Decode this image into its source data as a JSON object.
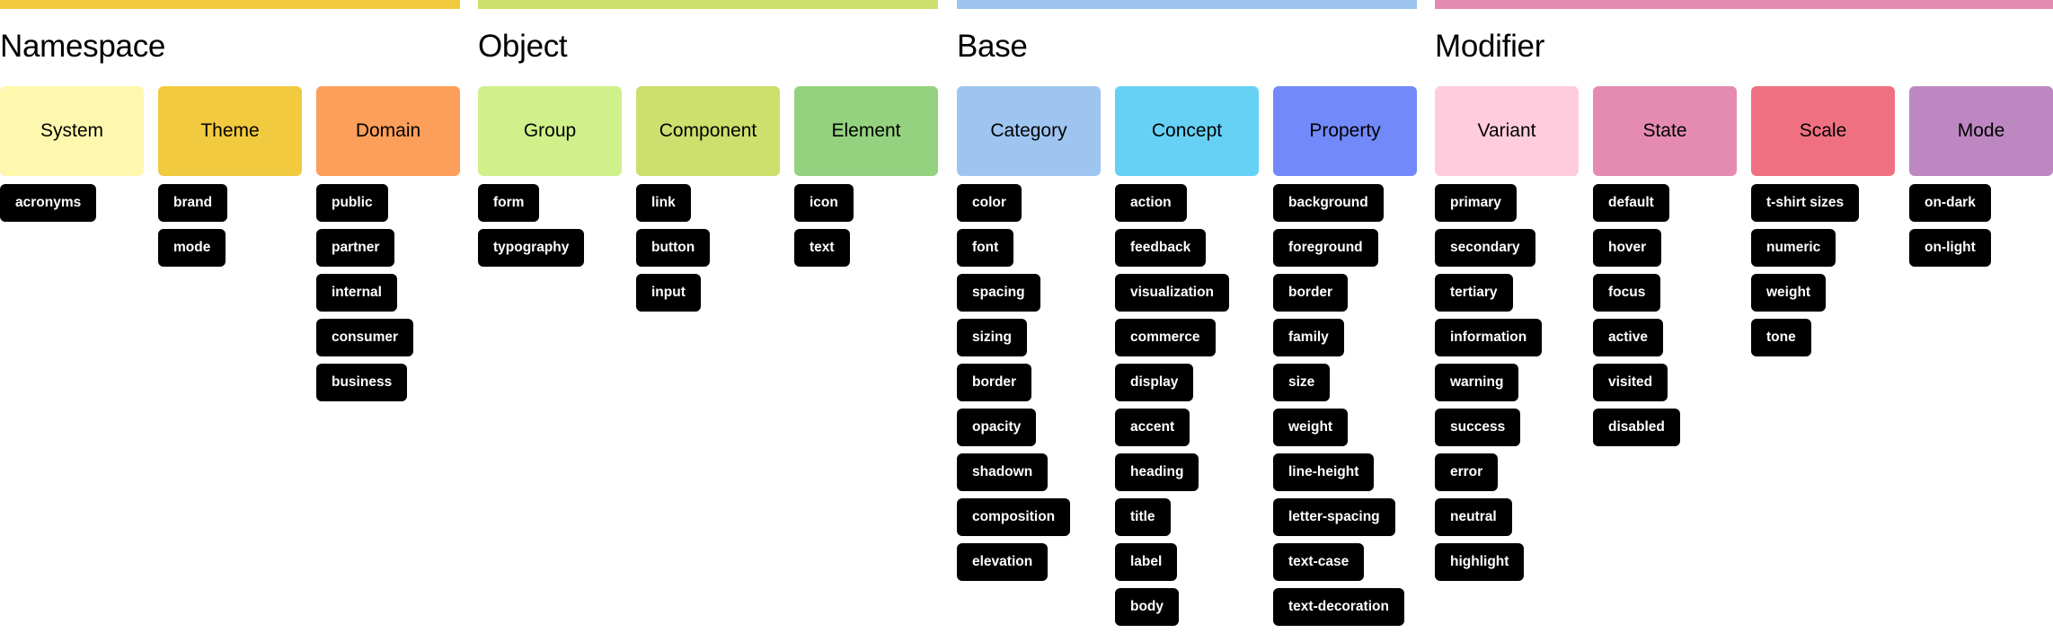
{
  "sections": [
    {
      "title": "Namespace",
      "color": "#F2CA3F",
      "columns": [
        {
          "label": "System",
          "color": "#FEF7AE",
          "tags": [
            "acronyms"
          ]
        },
        {
          "label": "Theme",
          "color": "#F2CA3F",
          "tags": [
            "brand",
            "mode"
          ]
        },
        {
          "label": "Domain",
          "color": "#FB9F5A",
          "tags": [
            "public",
            "partner",
            "internal",
            "consumer",
            "business"
          ]
        }
      ]
    },
    {
      "title": "Object",
      "color": "#CDDF6C",
      "columns": [
        {
          "label": "Group",
          "color": "#D0F08B",
          "tags": [
            "form",
            "typography"
          ]
        },
        {
          "label": "Component",
          "color": "#CDDF6C",
          "tags": [
            "link",
            "button",
            "input"
          ]
        },
        {
          "label": "Element",
          "color": "#95D27F",
          "tags": [
            "icon",
            "text"
          ]
        }
      ]
    },
    {
      "title": "Base",
      "color": "#9DC5F0",
      "columns": [
        {
          "label": "Category",
          "color": "#9DC5F0",
          "tags": [
            "color",
            "font",
            "spacing",
            "sizing",
            "border",
            "opacity",
            "shadown",
            "composition",
            "elevation"
          ]
        },
        {
          "label": "Concept",
          "color": "#66D1F4",
          "tags": [
            "action",
            "feedback",
            "visualization",
            "commerce",
            "display",
            "accent",
            "heading",
            "title",
            "label",
            "body"
          ]
        },
        {
          "label": "Property",
          "color": "#7289F9",
          "tags": [
            "background",
            "foreground",
            "border",
            "family",
            "size",
            "weight",
            "line-height",
            "letter-spacing",
            "text-case",
            "text-decoration"
          ]
        }
      ]
    },
    {
      "title": "Modifier",
      "color": "#E58BB1",
      "columns": [
        {
          "label": "Variant",
          "color": "#FFCCDE",
          "tags": [
            "primary",
            "secondary",
            "tertiary",
            "information",
            "warning",
            "success",
            "error",
            "neutral",
            "highlight"
          ]
        },
        {
          "label": "State",
          "color": "#E58BB1",
          "tags": [
            "default",
            "hover",
            "focus",
            "active",
            "visited",
            "disabled"
          ]
        },
        {
          "label": "Scale",
          "color": "#EF7181",
          "tags": [
            "t-shirt sizes",
            "numeric",
            "weight",
            "tone"
          ]
        },
        {
          "label": "Mode",
          "color": "#BD88C2",
          "tags": [
            "on-dark",
            "on-light"
          ]
        }
      ]
    }
  ]
}
